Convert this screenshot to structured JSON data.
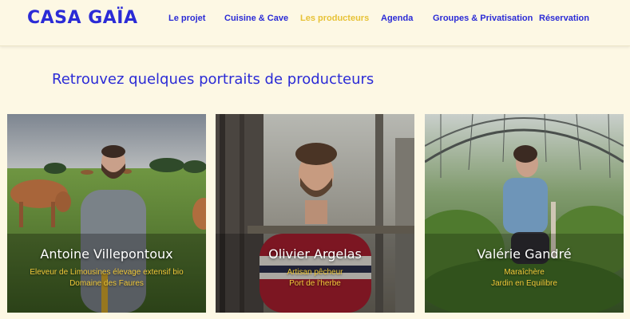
{
  "brand": {
    "logo": "CASA GAÏA"
  },
  "nav": {
    "items": [
      {
        "label": "Le projet"
      },
      {
        "label": "Cuisine & Cave"
      },
      {
        "label": "Les producteurs"
      },
      {
        "label": "Agenda"
      },
      {
        "label": "Groupes & Privatisation"
      },
      {
        "label": "Réservation"
      }
    ],
    "active": "Les producteurs"
  },
  "main": {
    "title": "Retrouvez quelques portraits de producteurs",
    "producers": [
      {
        "name": "Antoine Villepontoux",
        "role": "Eleveur de Limousines élevage extensif bio",
        "place": "Domaine des Faures"
      },
      {
        "name": "Olivier Argelas",
        "role": "Artisan pêcheur",
        "place": "Port de l'herbe"
      },
      {
        "name": "Valérie Gandré",
        "role": "Maraîchère",
        "place": "Jardin en Equilibre"
      }
    ]
  },
  "colors": {
    "brand_blue": "#2b2bd6",
    "accent_yellow": "#f1c93a",
    "background": "#fdf8e4"
  }
}
